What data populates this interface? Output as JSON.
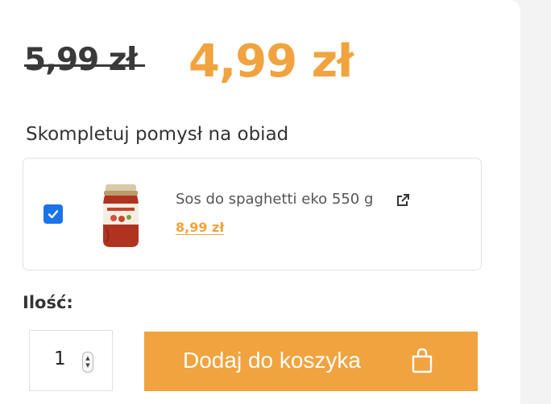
{
  "pricing": {
    "old_price": "5,99 zł",
    "new_price": "4,99 zł"
  },
  "bundle": {
    "title": "Skompletuj pomysł na obiad",
    "item": {
      "checked": true,
      "name": "Sos do spaghetti eko 550 g",
      "price": "8,99 zł",
      "image_icon": "sauce-jar-icon",
      "link_icon": "external-link-icon"
    }
  },
  "quantity": {
    "label": "Ilość:",
    "value": "1"
  },
  "cart": {
    "button_label": "Dodaj do koszyka",
    "icon": "shopping-bag-icon"
  },
  "colors": {
    "accent": "#f0a33e",
    "checkbox": "#1a73e8",
    "text": "#333333"
  }
}
